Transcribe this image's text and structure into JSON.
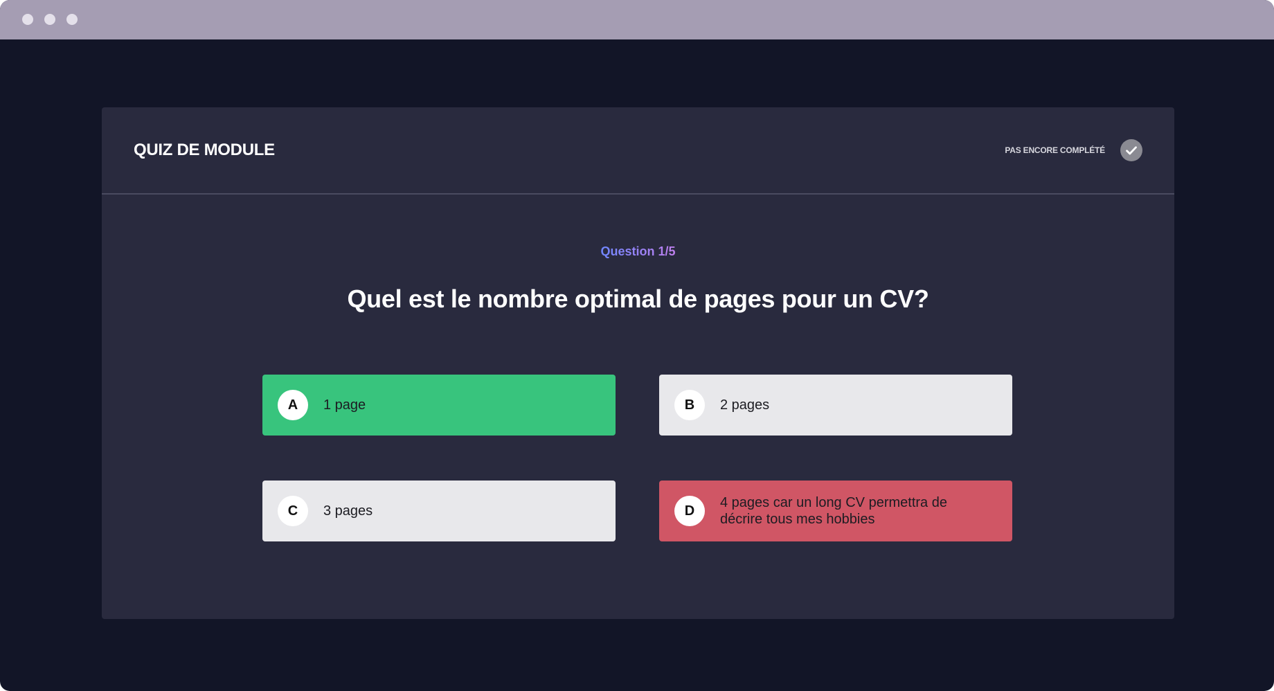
{
  "quiz": {
    "title": "QUIZ DE MODULE",
    "status_label": "PAS ENCORE COMPLÉTÉ",
    "status_icon": "check-circle-icon",
    "question_number": "Question 1/5",
    "question": "Quel est le nombre optimal de pages pour un CV?",
    "answers": [
      {
        "letter": "A",
        "text": "1 page",
        "state": "correct",
        "color": "#38c47d"
      },
      {
        "letter": "B",
        "text": "2 pages",
        "state": "neutral",
        "color": "#e8e8eb"
      },
      {
        "letter": "C",
        "text": "3 pages",
        "state": "neutral",
        "color": "#e8e8eb"
      },
      {
        "letter": "D",
        "text": "4 pages car un long CV permettra de décrire tous mes hobbies",
        "state": "wrong",
        "color": "#d05665"
      }
    ]
  },
  "theme": {
    "background": "#121527",
    "card": "#292a3e",
    "titlebar": "#a59db3",
    "accent_gradient": [
      "#6f86ff",
      "#c080ee"
    ]
  }
}
